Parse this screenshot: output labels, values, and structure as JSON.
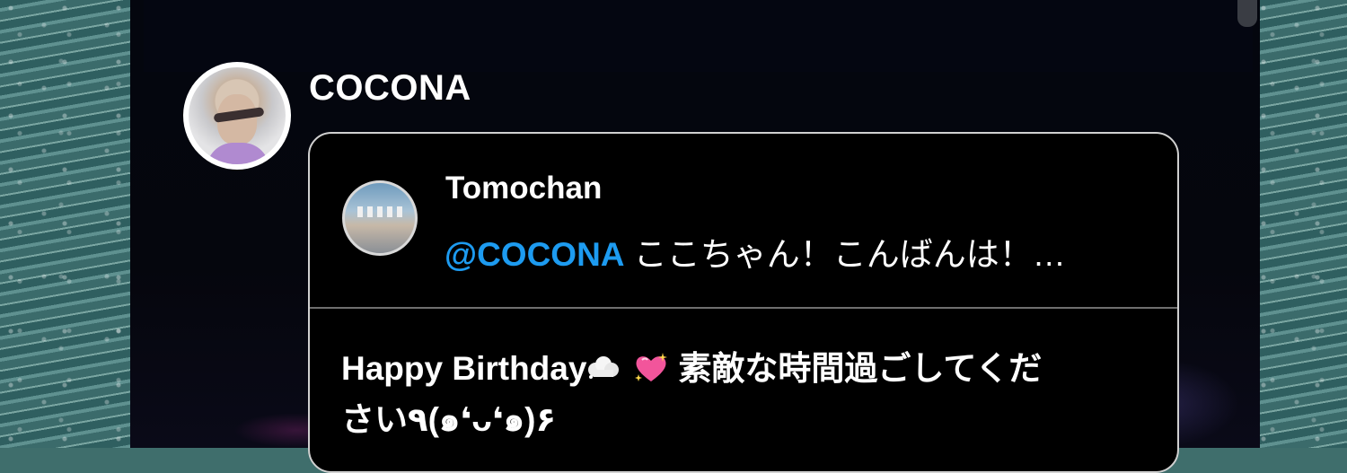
{
  "profile": {
    "username": "COCONA"
  },
  "quoted_post": {
    "author": "Tomochan",
    "mention": "@COCONA",
    "text": " ここちゃん！こんばんは！…"
  },
  "reply": {
    "line1_pre": "Happy Birthday",
    "line1_post": "素敵な時間過ごしてくだ",
    "line2": "さい٩(๑❛ᴗ❛๑)۶",
    "emoji_after_birthday": "cloud-icon",
    "emoji_heart": "sparkling-heart-icon"
  },
  "colors": {
    "background": "#05060d",
    "mention": "#1d9bf0",
    "card_border": "#d0d0d0"
  }
}
